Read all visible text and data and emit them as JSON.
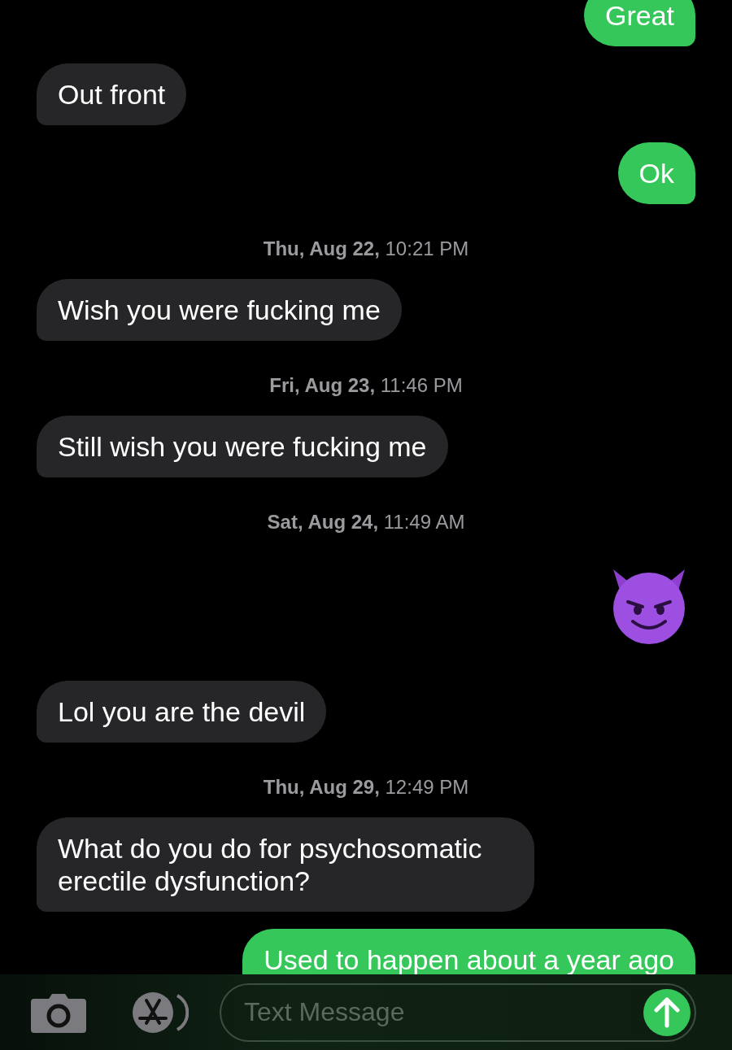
{
  "messages": [
    {
      "kind": "sent",
      "text": "Great"
    },
    {
      "kind": "received",
      "text": "Out front"
    },
    {
      "kind": "sent",
      "text": "Ok"
    },
    {
      "kind": "timestamp",
      "text": "**Thu, Aug 22,** 10:21 PM"
    },
    {
      "kind": "received",
      "text": "Wish you were fucking me"
    },
    {
      "kind": "timestamp",
      "text": "**Fri, Aug 23,** 11:46 PM"
    },
    {
      "kind": "received",
      "text": "Still wish you were fucking me"
    },
    {
      "kind": "timestamp",
      "text": "**Sat, Aug 24,** 11:49 AM"
    },
    {
      "kind": "emoji"
    },
    {
      "kind": "received",
      "text": "Lol you are the devil"
    },
    {
      "kind": "timestamp",
      "text": "**Thu, Aug 29,** 12:49 PM"
    },
    {
      "kind": "received",
      "text": "What do you do for psychosomatic erectile dysfunction?"
    },
    {
      "kind": "sent",
      "text": "Used to happen about a year ago"
    }
  ],
  "composer": {
    "placeholder": "Text Message"
  }
}
